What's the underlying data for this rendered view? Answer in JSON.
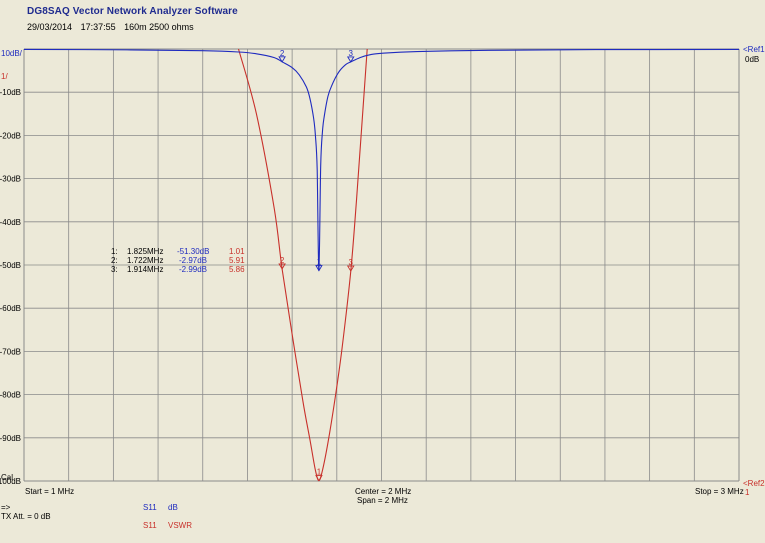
{
  "window": {
    "title": "DG8SAQ Vector Network Analyzer Software",
    "date": "29/03/2014",
    "time": "17:37:55",
    "comment": "160m 2500 ohms"
  },
  "left_labels": {
    "top_db": "10dB/",
    "top_vswr": "1/",
    "cal": "Cal",
    "arrow": "=>",
    "tx_att": "TX Att. = 0 dB"
  },
  "right_labels": {
    "ref1": "<Ref1",
    "ref1_value": "0dB",
    "ref2": "<Ref2",
    "ref2_value": "1"
  },
  "bottom_labels": {
    "start": "Start = 1 MHz",
    "center": "Center = 2 MHz",
    "span": "Span = 2 MHz",
    "stop": "Stop = 3 MHz"
  },
  "legend": [
    {
      "param": "S11",
      "format": "dB",
      "color": "#1f2bbf"
    },
    {
      "param": "S11",
      "format": "VSWR",
      "color": "#c8302a"
    }
  ],
  "markers": [
    {
      "id": "1",
      "freq": "1.825MHz",
      "s11": "-51.30dB",
      "vswr": "1.01"
    },
    {
      "id": "2",
      "freq": "1.722MHz",
      "s11": "-2.97dB",
      "vswr": "5.91"
    },
    {
      "id": "3",
      "freq": "1.914MHz",
      "s11": "-2.99dB",
      "vswr": "5.86"
    }
  ],
  "colors": {
    "background": "#ece9d8",
    "grid": "#8a8a8a",
    "s11_db": "#1f2bbf",
    "s11_vswr": "#c8302a",
    "title": "#1f2b8f"
  },
  "chart_data": {
    "type": "line",
    "title": "",
    "x_unit": "MHz",
    "xlim": [
      1,
      3
    ],
    "ylim_db": [
      -100,
      0
    ],
    "ylim_vswr": [
      1,
      11
    ],
    "grid": true,
    "y_tick_labels": [
      "-10dB",
      "-20dB",
      "-30dB",
      "-40dB",
      "-50dB",
      "-60dB",
      "-70dB",
      "-80dB",
      "-90dB",
      "-100dB"
    ],
    "y_tick_values": [
      -10,
      -20,
      -30,
      -40,
      -50,
      -60,
      -70,
      -80,
      -90,
      -100
    ],
    "series": [
      {
        "name": "S11 dB",
        "axis": "db",
        "x": [
          1.0,
          1.3,
          1.5,
          1.6,
          1.65,
          1.7,
          1.722,
          1.75,
          1.77,
          1.79,
          1.8,
          1.81,
          1.815,
          1.82,
          1.825,
          1.83,
          1.835,
          1.84,
          1.85,
          1.86,
          1.88,
          1.9,
          1.914,
          1.94,
          1.97,
          2.0,
          2.1,
          2.3,
          2.6,
          3.0
        ],
        "y": [
          -0.1,
          -0.2,
          -0.4,
          -0.7,
          -1.1,
          -2.0,
          -2.97,
          -4.3,
          -6.0,
          -8.8,
          -11.5,
          -16,
          -20,
          -28,
          -51.3,
          -27,
          -19,
          -15.5,
          -11,
          -8.6,
          -5.4,
          -3.6,
          -2.99,
          -2.0,
          -1.3,
          -1.0,
          -0.6,
          -0.3,
          -0.15,
          -0.1
        ]
      },
      {
        "name": "S11 VSWR",
        "axis": "vswr",
        "x": [
          1.6,
          1.65,
          1.7,
          1.722,
          1.75,
          1.78,
          1.8,
          1.815,
          1.825,
          1.835,
          1.85,
          1.87,
          1.89,
          1.914,
          1.93,
          1.96
        ],
        "y": [
          11,
          9.5,
          7.3,
          5.91,
          4.4,
          2.85,
          1.95,
          1.25,
          1.01,
          1.25,
          1.88,
          2.9,
          4.1,
          5.86,
          7.5,
          11
        ]
      }
    ],
    "marker_points": [
      {
        "id": "1",
        "x": 1.825,
        "db": -51.3,
        "vswr": 1.01
      },
      {
        "id": "2",
        "x": 1.722,
        "db": -2.97,
        "vswr": 5.91
      },
      {
        "id": "3",
        "x": 1.914,
        "db": -2.99,
        "vswr": 5.86
      }
    ]
  }
}
